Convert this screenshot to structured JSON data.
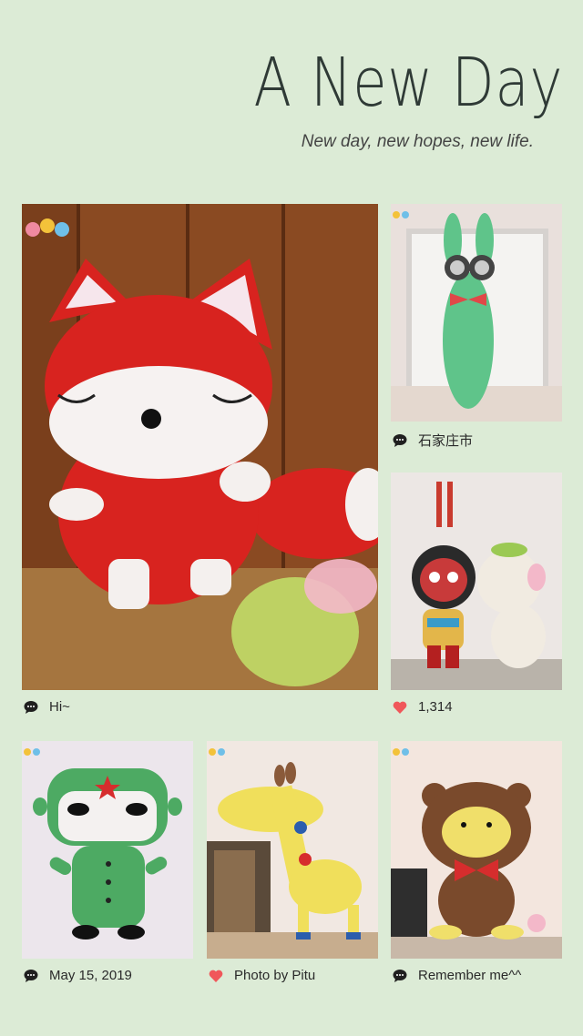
{
  "header": {
    "title": "A New Day",
    "subtitle": "New day, new hopes, new life."
  },
  "colors": {
    "background": "#dcebd6",
    "heart": "#f0575a",
    "comment": "#1f1f1f"
  },
  "photos": [
    {
      "subject": "red fox plush toy",
      "caption_icon": "comment-icon",
      "caption": "Hi~"
    },
    {
      "subject": "green bunny plush with goggles",
      "caption_icon": "comment-icon",
      "caption": "石家庄市"
    },
    {
      "subject": "monkey king and monkey plush toys",
      "caption_icon": "heart-icon",
      "caption": "1,314"
    },
    {
      "subject": "green soldier plush toy",
      "caption_icon": "comment-icon",
      "caption": "May 15, 2019"
    },
    {
      "subject": "yellow giraffe plush toy",
      "caption_icon": "heart-icon",
      "caption": "Photo by Pitu"
    },
    {
      "subject": "brown bear plush with red bow",
      "caption_icon": "comment-icon",
      "caption": "Remember me^^"
    }
  ]
}
